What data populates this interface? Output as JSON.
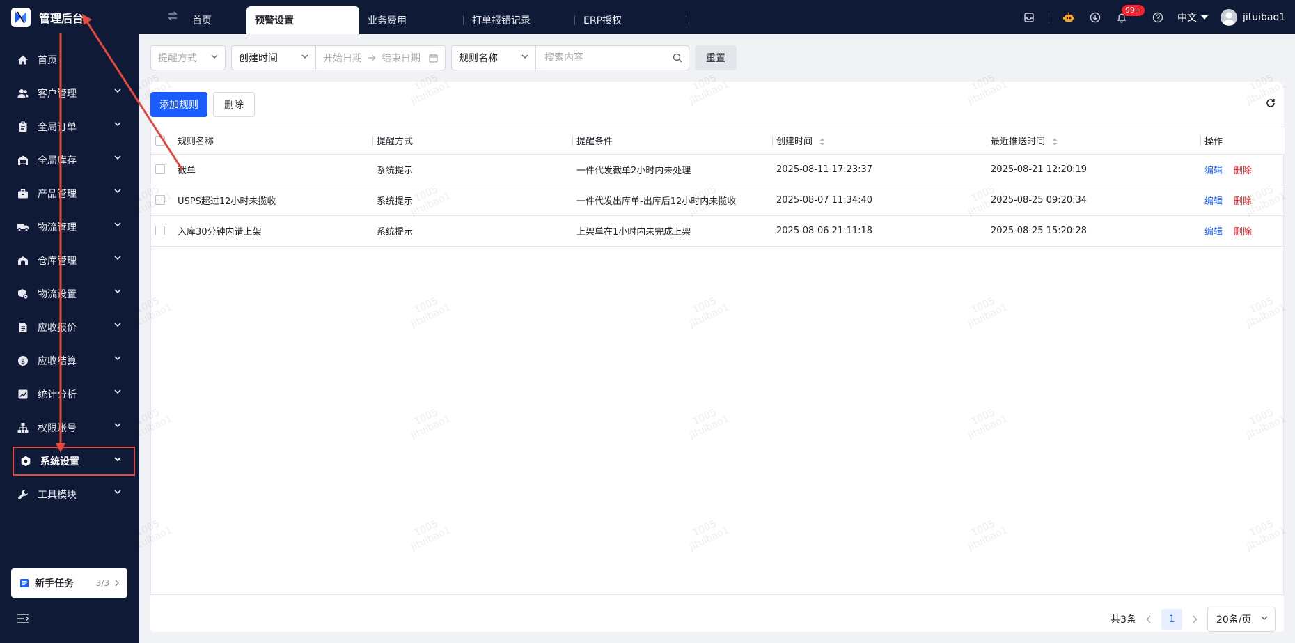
{
  "app": {
    "title": "管理后台"
  },
  "tabs": [
    {
      "label": "首页"
    },
    {
      "label": "预警设置",
      "active": true
    },
    {
      "label": "业务费用"
    },
    {
      "label": "打单报错记录"
    },
    {
      "label": "ERP授权"
    }
  ],
  "topbar": {
    "notification_badge": "99+",
    "language": "中文",
    "username": "jituibao1"
  },
  "sidebar": {
    "items": [
      {
        "label": "首页",
        "icon": "home-icon"
      },
      {
        "label": "客户管理",
        "icon": "users-icon"
      },
      {
        "label": "全局订单",
        "icon": "clipboard-icon"
      },
      {
        "label": "全局库存",
        "icon": "warehouse-icon"
      },
      {
        "label": "产品管理",
        "icon": "briefcase-icon"
      },
      {
        "label": "物流管理",
        "icon": "truck-icon"
      },
      {
        "label": "仓库管理",
        "icon": "store-icon"
      },
      {
        "label": "物流设置",
        "icon": "box-gear-icon"
      },
      {
        "label": "应收报价",
        "icon": "document-icon"
      },
      {
        "label": "应收结算",
        "icon": "dollar-icon"
      },
      {
        "label": "统计分析",
        "icon": "chart-icon"
      },
      {
        "label": "权限账号",
        "icon": "org-chart-icon"
      },
      {
        "label": "系统设置",
        "icon": "hexagon-gear-icon",
        "active": true
      },
      {
        "label": "工具模块",
        "icon": "wrench-icon"
      }
    ],
    "task_card": {
      "label": "新手任务",
      "count": "3/3"
    }
  },
  "filters": {
    "remind_method_placeholder": "提醒方式",
    "time_type": "创建时间",
    "start_date_placeholder": "开始日期",
    "end_date_placeholder": "结束日期",
    "field_select": "规则名称",
    "search_placeholder": "搜索内容",
    "reset_label": "重置"
  },
  "toolbar": {
    "add_label": "添加规则",
    "delete_label": "删除"
  },
  "table": {
    "columns": [
      "规则名称",
      "提醒方式",
      "提醒条件",
      "创建时间",
      "最近推送时间",
      "操作"
    ],
    "rows": [
      {
        "name": "截单",
        "method": "系统提示",
        "condition": "一件代发截单2小时内未处理",
        "created": "2025-08-11 17:23:37",
        "last_push": "2025-08-21 12:20:19"
      },
      {
        "name": "USPS超过12小时未揽收",
        "method": "系统提示",
        "condition": "一件代发出库单-出库后12小时内未揽收",
        "created": "2025-08-07 11:34:40",
        "last_push": "2025-08-25 09:20:34"
      },
      {
        "name": "入库30分钟内请上架",
        "method": "系统提示",
        "condition": "上架单在1小时内未完成上架",
        "created": "2025-08-06 21:11:18",
        "last_push": "2025-08-25 15:20:28"
      }
    ],
    "edit_label": "编辑",
    "delete_label": "删除"
  },
  "pagination": {
    "total": "共3条",
    "current_page": "1",
    "page_size": "20条/页"
  },
  "watermark": {
    "line1": "1005",
    "line2": "jituibao1"
  },
  "colors": {
    "primary": "#1a5cff",
    "danger": "#f5222d",
    "sidebar_bg": "#0f1a36",
    "annotation": "#e34a3c"
  }
}
